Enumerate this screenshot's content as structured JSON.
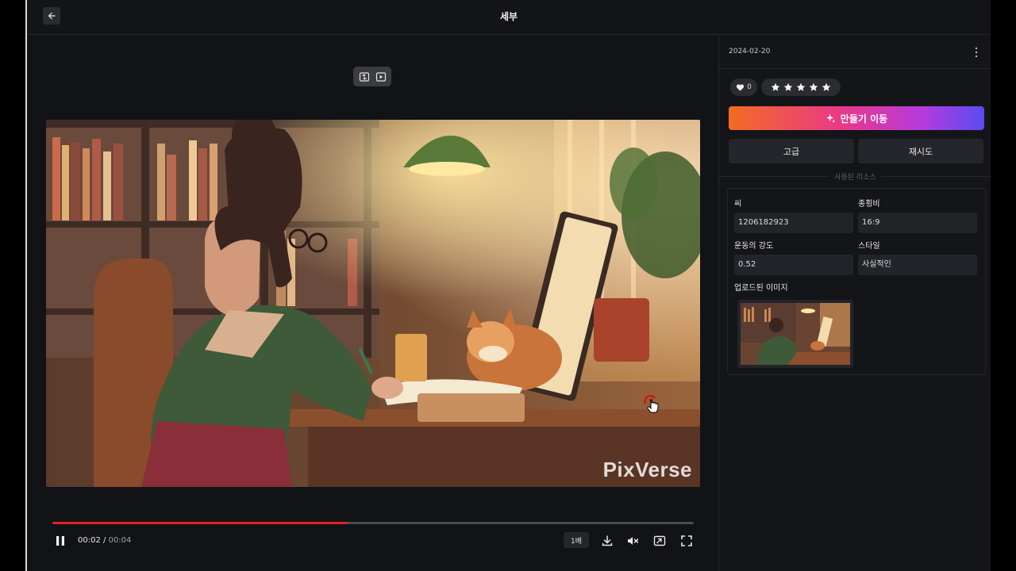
{
  "header": {
    "title": "세부"
  },
  "player": {
    "watermark": "PixVerse",
    "current_time": "00:02",
    "separator": "/",
    "duration": "00:04",
    "progress": 0.46,
    "speed_label": "1배"
  },
  "panel": {
    "date": "2024-02-20",
    "like_count": "0",
    "rating_stars": 5,
    "create_label": "만들기 이동",
    "advanced_label": "고급",
    "retry_label": "재시도",
    "section_label": "사용된 리소스",
    "params": {
      "seed_label": "씨",
      "seed_value": "1206182923",
      "ratio_label": "종횡비",
      "ratio_value": "16:9",
      "motion_label": "운동의 강도",
      "motion_value": "0.52",
      "style_label": "스타일",
      "style_value": "사실적인",
      "uploaded_label": "업로드된 이미지"
    }
  },
  "colors": {
    "progress": "#e02424",
    "gradient_start": "#f36b22",
    "gradient_end": "#5a4bf2"
  }
}
